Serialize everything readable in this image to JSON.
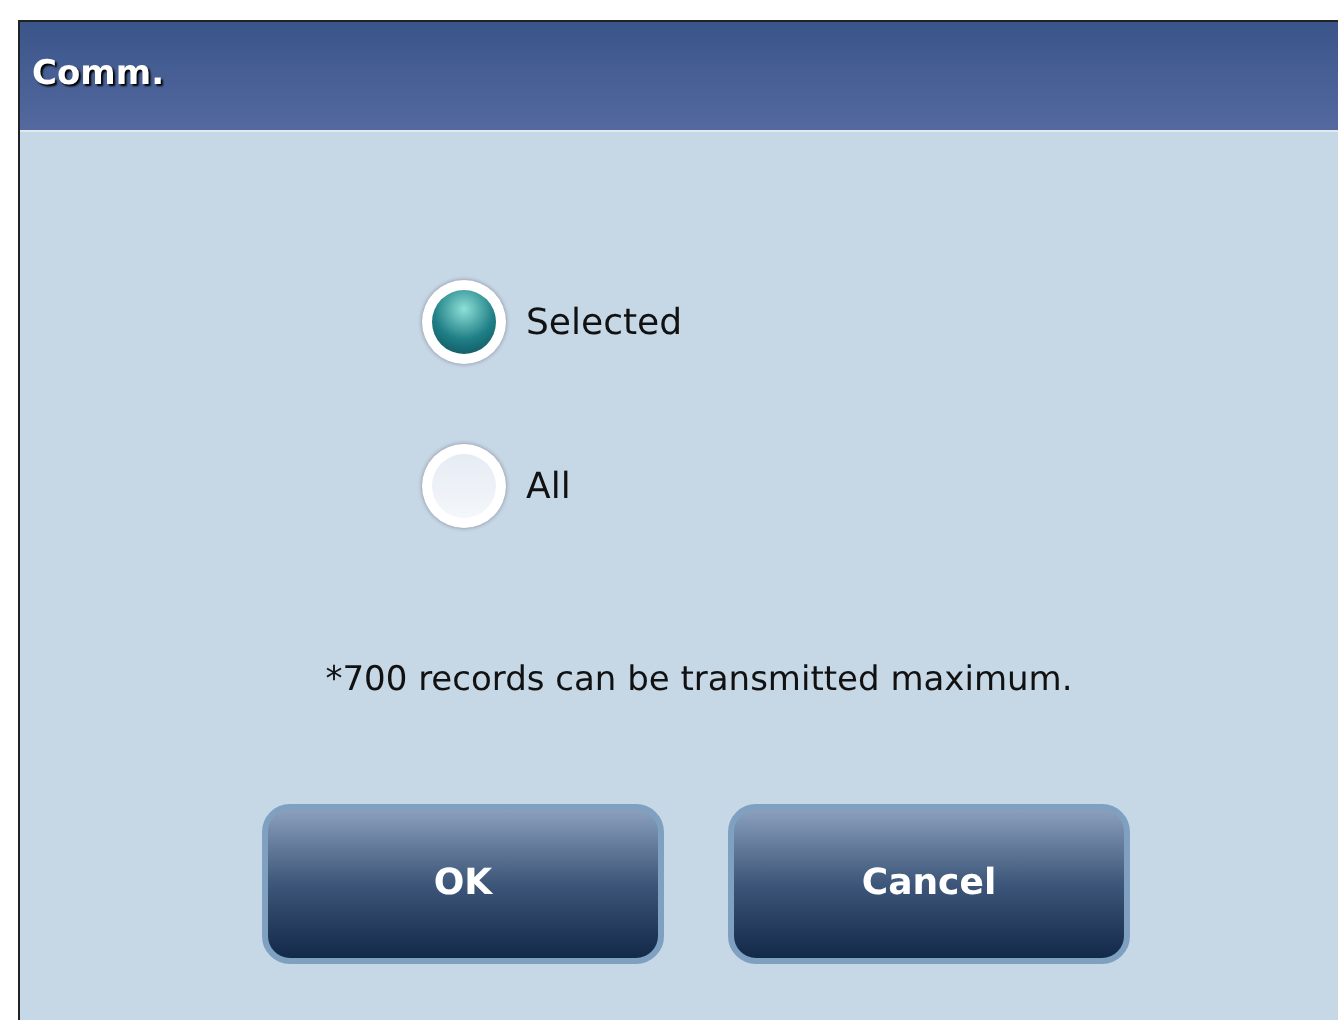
{
  "window": {
    "title": "Comm."
  },
  "options": [
    {
      "label": "Selected",
      "selected": true
    },
    {
      "label": "All",
      "selected": false
    }
  ],
  "note": "*700 records can be transmitted maximum.",
  "buttons": [
    "OK",
    "Cancel"
  ]
}
